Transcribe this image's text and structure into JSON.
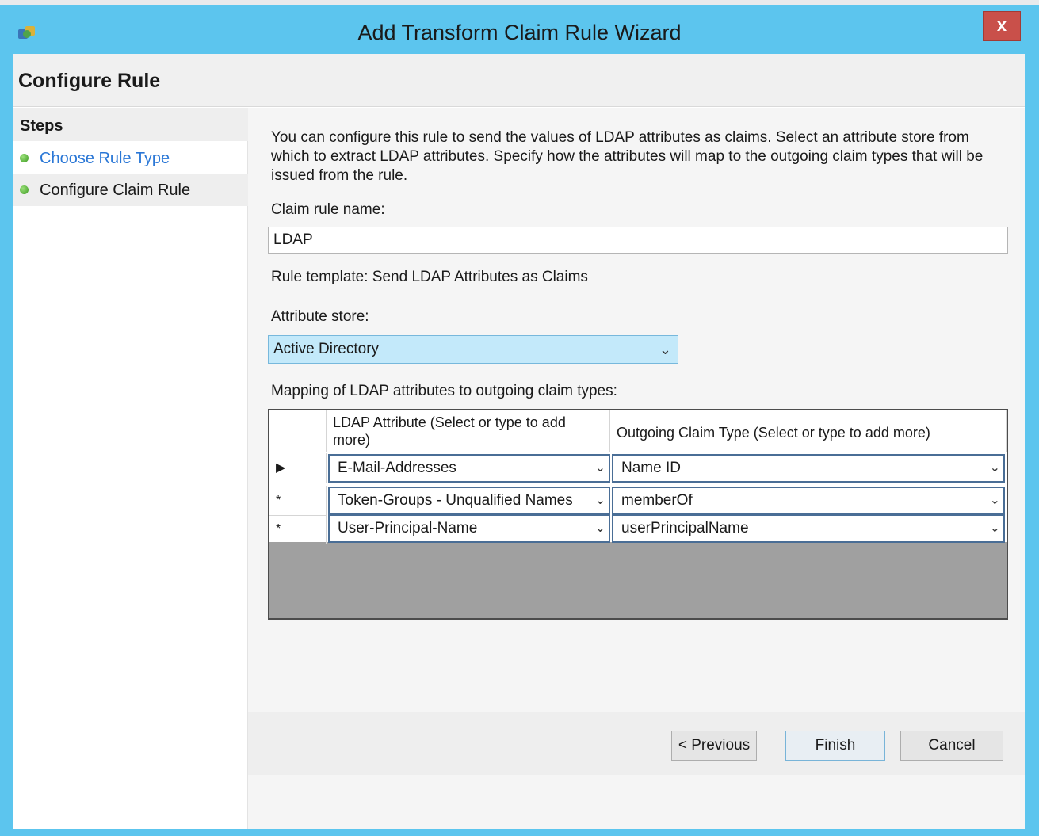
{
  "window": {
    "title": "Add Transform Claim Rule Wizard",
    "close_label": "x"
  },
  "header": {
    "title": "Configure Rule"
  },
  "sidebar": {
    "heading": "Steps",
    "steps": [
      {
        "label": "Choose Rule Type",
        "state": "link"
      },
      {
        "label": "Configure Claim Rule",
        "state": "current"
      }
    ]
  },
  "main": {
    "description": "You can configure this rule to send the values of LDAP attributes as claims. Select an attribute store from which to extract LDAP attributes. Specify how the attributes will map to the outgoing claim types that will be issued from the rule.",
    "claim_rule_name_label": "Claim rule name:",
    "claim_rule_name_value": "LDAP",
    "rule_template": "Rule template: Send LDAP Attributes as Claims",
    "attribute_store_label": "Attribute store:",
    "attribute_store_value": "Active Directory",
    "mapping_label": "Mapping of LDAP attributes to outgoing claim types:",
    "grid": {
      "headers": [
        "",
        "LDAP Attribute (Select or type to add more)",
        "Outgoing Claim Type (Select or type to add more)"
      ],
      "rows": [
        {
          "marker": "▶",
          "ldap": "E-Mail-Addresses",
          "claim": "Name ID"
        },
        {
          "marker": "*",
          "ldap": "Token-Groups - Unqualified Names",
          "claim": "memberOf"
        },
        {
          "marker": "*",
          "ldap": "User-Principal-Name",
          "claim": "userPrincipalName"
        }
      ]
    }
  },
  "footer": {
    "previous_label": "< Previous",
    "finish_label": "Finish",
    "cancel_label": "Cancel"
  },
  "colors": {
    "titlebar": "#5cc5ee",
    "close": "#c9504a",
    "link": "#2a77d6",
    "selected_field": "#c3e9fa"
  },
  "icons": [
    "app-icon",
    "close-icon",
    "chevron-down-icon",
    "step-complete-icon",
    "row-pointer-icon"
  ]
}
